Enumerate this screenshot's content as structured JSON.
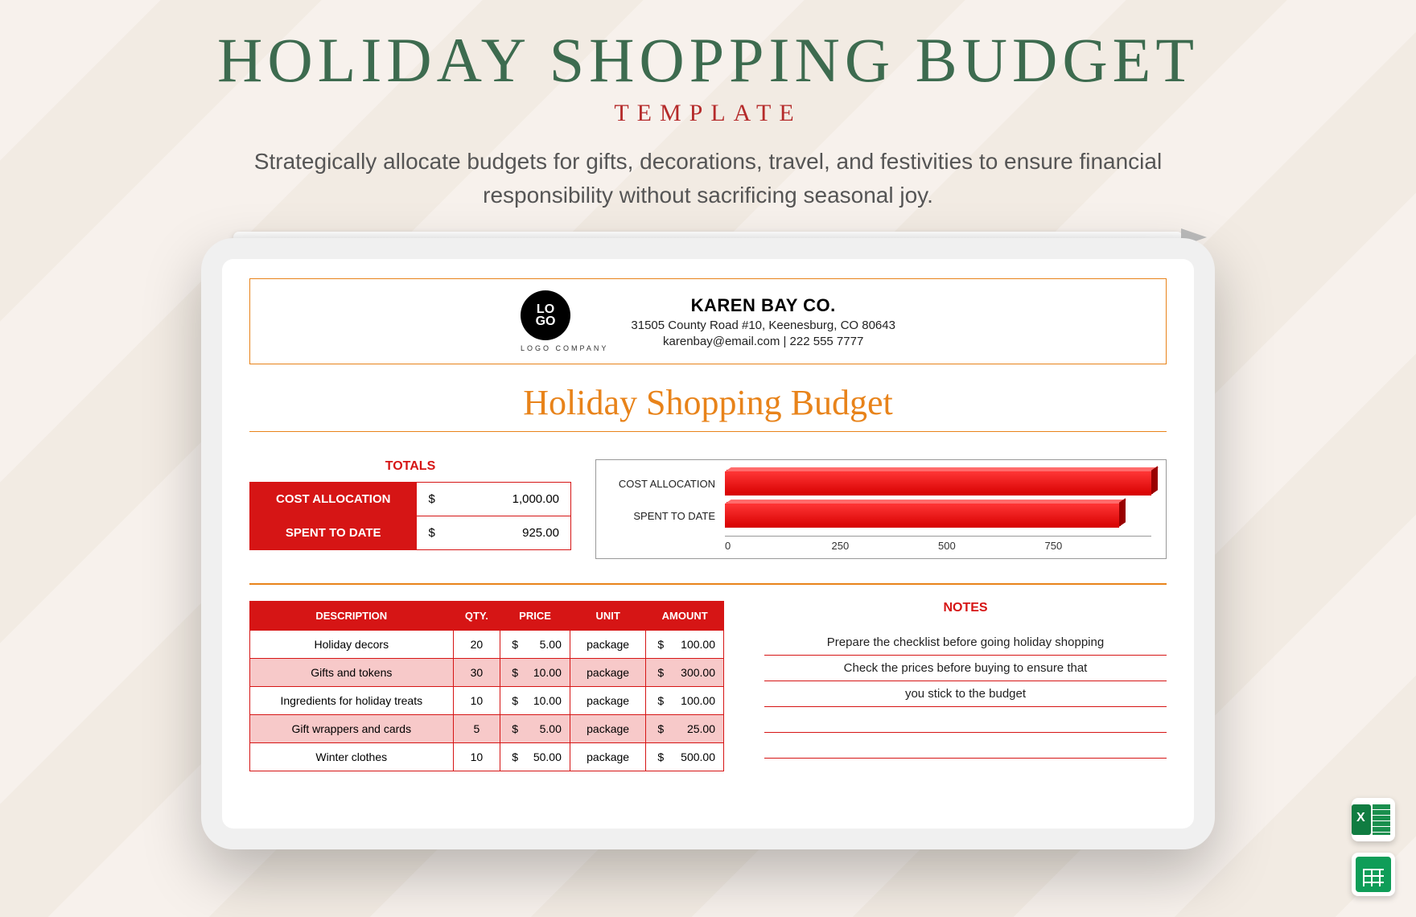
{
  "header": {
    "main_title": "HOLIDAY SHOPPING BUDGET",
    "sub_title": "TEMPLATE",
    "tagline": "Strategically allocate budgets for gifts, decorations, travel, and festivities to ensure financial responsibility without sacrificing seasonal joy."
  },
  "company": {
    "logo_top": "LO",
    "logo_bot": "GO",
    "logo_sub": "LOGO COMPANY",
    "name": "KAREN BAY CO.",
    "address": "31505 County Road #10, Keenesburg, CO 80643",
    "contact": "karenbay@email.com | 222 555 7777"
  },
  "doc_title": "Holiday Shopping Budget",
  "totals": {
    "label": "TOTALS",
    "rows": [
      {
        "key": "COST ALLOCATION",
        "cur": "$",
        "val": "1,000.00"
      },
      {
        "key": "SPENT TO DATE",
        "cur": "$",
        "val": "925.00"
      }
    ]
  },
  "chart_data": {
    "type": "bar",
    "orientation": "horizontal",
    "categories": [
      "COST ALLOCATION",
      "SPENT TO DATE"
    ],
    "values": [
      1000,
      925
    ],
    "xlim": [
      0,
      1000
    ],
    "ticks": [
      "0",
      "250",
      "500",
      "750"
    ]
  },
  "items": {
    "headers": [
      "DESCRIPTION",
      "QTY.",
      "PRICE",
      "UNIT",
      "AMOUNT"
    ],
    "rows": [
      {
        "desc": "Holiday decors",
        "qty": "20",
        "price": "5.00",
        "unit": "package",
        "amount": "100.00",
        "alt": false
      },
      {
        "desc": "Gifts and tokens",
        "qty": "30",
        "price": "10.00",
        "unit": "package",
        "amount": "300.00",
        "alt": true
      },
      {
        "desc": "Ingredients for holiday treats",
        "qty": "10",
        "price": "10.00",
        "unit": "package",
        "amount": "100.00",
        "alt": false
      },
      {
        "desc": "Gift wrappers and cards",
        "qty": "5",
        "price": "5.00",
        "unit": "package",
        "amount": "25.00",
        "alt": true
      },
      {
        "desc": "Winter clothes",
        "qty": "10",
        "price": "50.00",
        "unit": "package",
        "amount": "500.00",
        "alt": false
      }
    ],
    "cur": "$"
  },
  "notes": {
    "title": "NOTES",
    "lines": [
      "Prepare the checklist before going holiday shopping",
      "Check the prices before buying to ensure that",
      "you stick to the budget",
      "",
      ""
    ]
  }
}
